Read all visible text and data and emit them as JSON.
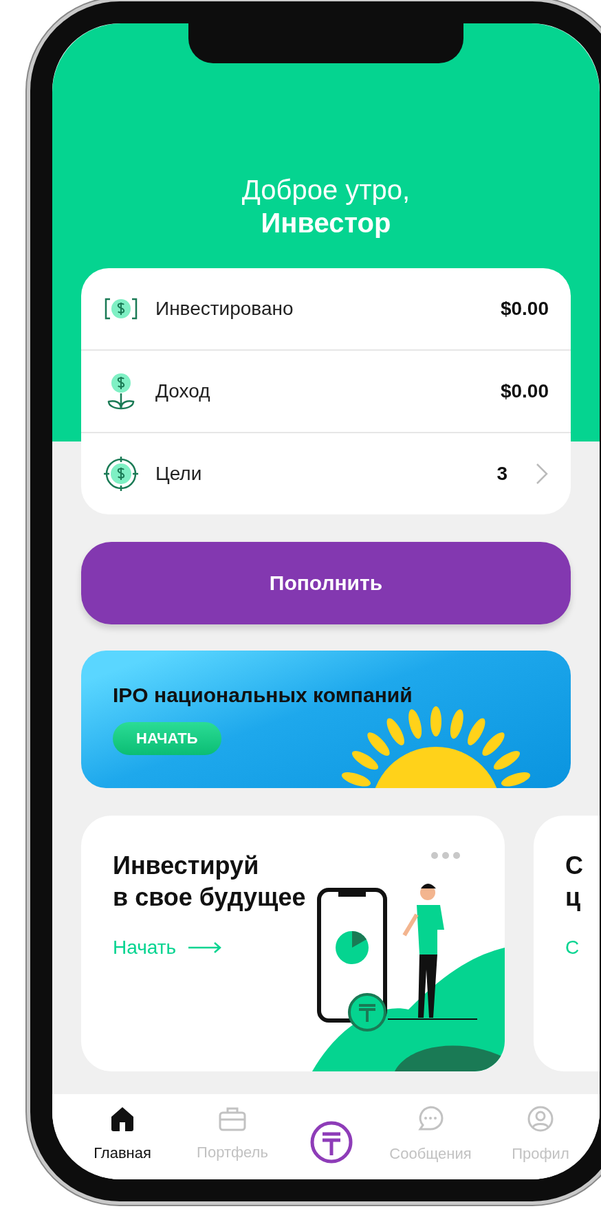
{
  "greeting": {
    "salutation": "Доброе утро,",
    "name": "Инвестор"
  },
  "summary": [
    {
      "kind": "invested",
      "label": "Инвестировано",
      "value": "$0.00",
      "chevron": false
    },
    {
      "kind": "income",
      "label": "Доход",
      "value": "$0.00",
      "chevron": false
    },
    {
      "kind": "goals",
      "label": "Цели",
      "value": "3",
      "chevron": true
    }
  ],
  "top_up_button": "Пополнить",
  "banner": {
    "title": "IPO национальных компаний",
    "button": "НАЧАТЬ"
  },
  "cards": [
    {
      "title_lines": [
        "Инвестируй",
        "в свое будущее"
      ],
      "link": "Начать",
      "menu": true
    },
    {
      "title_lines": [
        "С",
        "ц"
      ],
      "link": "С",
      "menu": false
    }
  ],
  "tab_bar": [
    {
      "kind": "home",
      "label": "Главная",
      "selected": true
    },
    {
      "kind": "portfolio",
      "label": "Портфель",
      "selected": false
    },
    {
      "kind": "logo",
      "selected": false
    },
    {
      "kind": "messages",
      "label": "Сообщения",
      "selected": false
    },
    {
      "kind": "profile",
      "label": "Профил",
      "selected": false
    }
  ]
}
